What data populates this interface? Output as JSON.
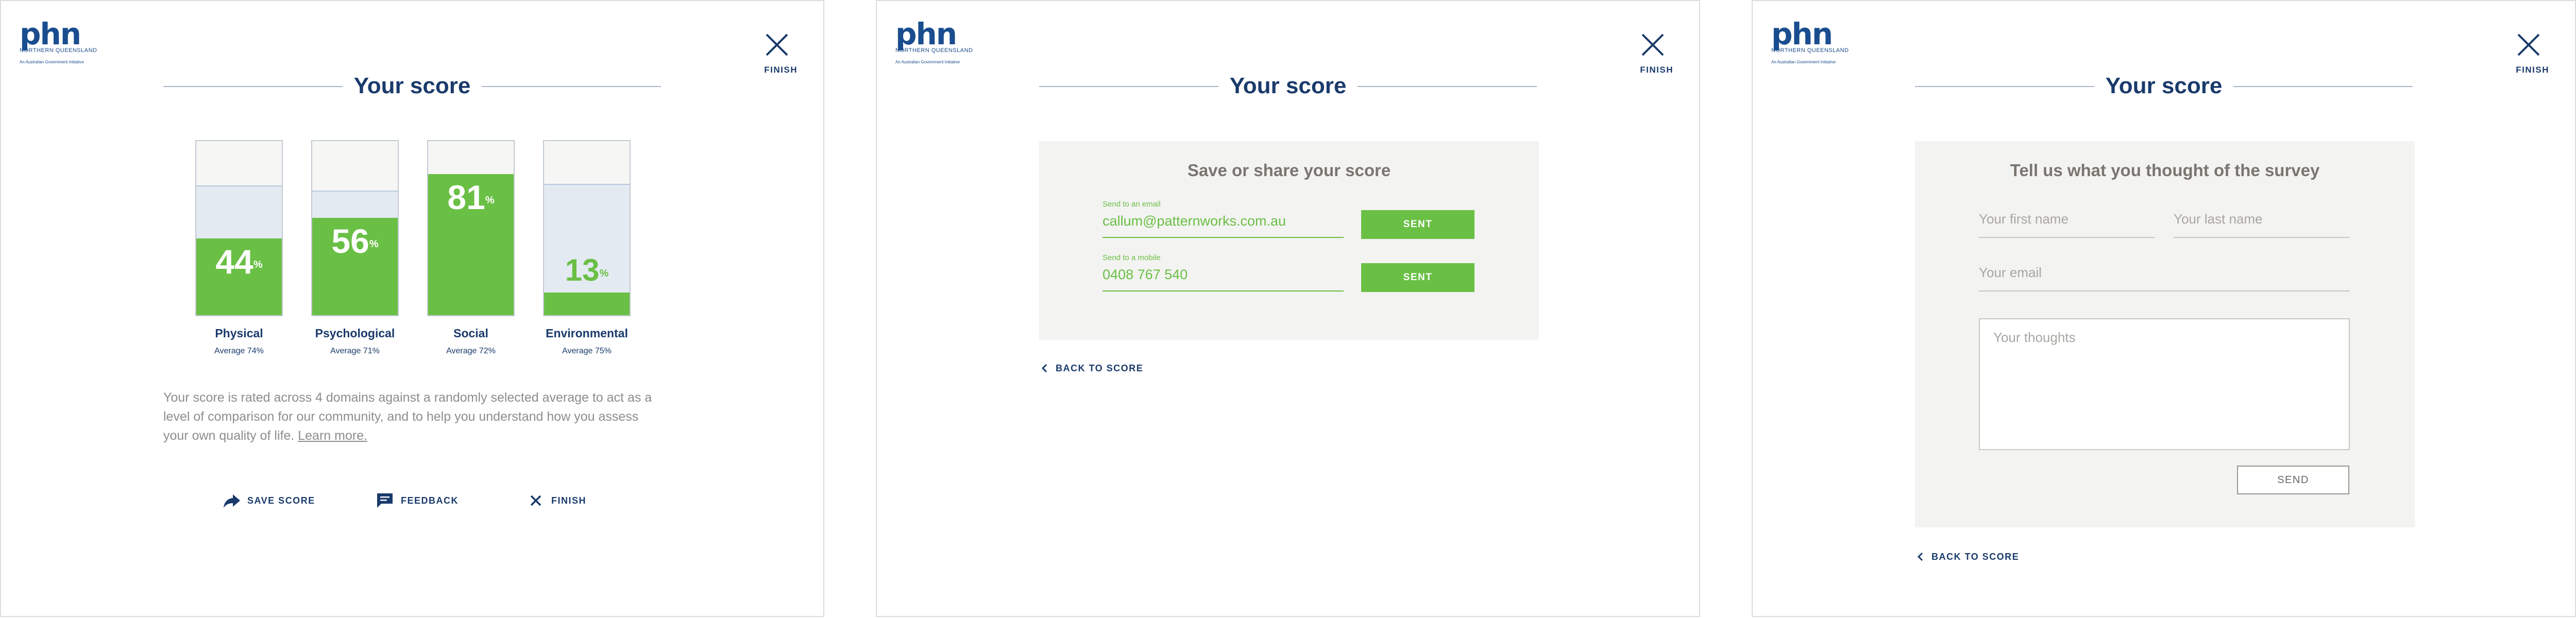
{
  "logo": {
    "word": "phn",
    "sub": "NORTHERN QUEENSLAND",
    "gov": "An Australian Government Initiative"
  },
  "finish_label": "FINISH",
  "title": "Your score",
  "colors": {
    "green": "#6abf45",
    "navy": "#1a3a6b",
    "card": "#f3f3f1"
  },
  "score_panel": {
    "domains": [
      {
        "label": "Physical",
        "value": 44,
        "display": "44",
        "pct": "%",
        "average_text": "Average 74%",
        "average": 74
      },
      {
        "label": "Psychological",
        "value": 56,
        "display": "56",
        "pct": "%",
        "average_text": "Average 71%",
        "average": 71
      },
      {
        "label": "Social",
        "value": 81,
        "display": "81",
        "pct": "%",
        "average_text": "Average 72%",
        "average": 72
      },
      {
        "label": "Environmental",
        "value": 13,
        "display": "13",
        "pct": "%",
        "average_text": "Average 75%",
        "average": 75
      }
    ],
    "description": "Your score is rated across 4 domains against a randomly selected average to act as a level of comparison for our community, and to help you understand how you assess your own quality of life.",
    "learn_more": "Learn more.",
    "actions": {
      "save": {
        "label": "SAVE SCORE",
        "icon": "share-arrow-icon"
      },
      "feedback": {
        "label": "FEEDBACK",
        "icon": "chat-icon"
      },
      "finish": {
        "label": "FINISH",
        "icon": "close-icon"
      }
    }
  },
  "share_panel": {
    "card_title": "Save or share your score",
    "email": {
      "label": "Send to an email",
      "value": "callum@patternworks.com.au",
      "button": "SENT"
    },
    "mobile": {
      "label": "Send to a mobile",
      "value": "0408 767 540",
      "button": "SENT"
    },
    "back": "BACK TO SCORE"
  },
  "feedback_panel": {
    "card_title": "Tell us what you thought of the survey",
    "first_name": "Your first name",
    "last_name": "Your last name",
    "email": "Your email",
    "thoughts": "Your thoughts",
    "send": "SEND",
    "back": "BACK TO SCORE"
  }
}
